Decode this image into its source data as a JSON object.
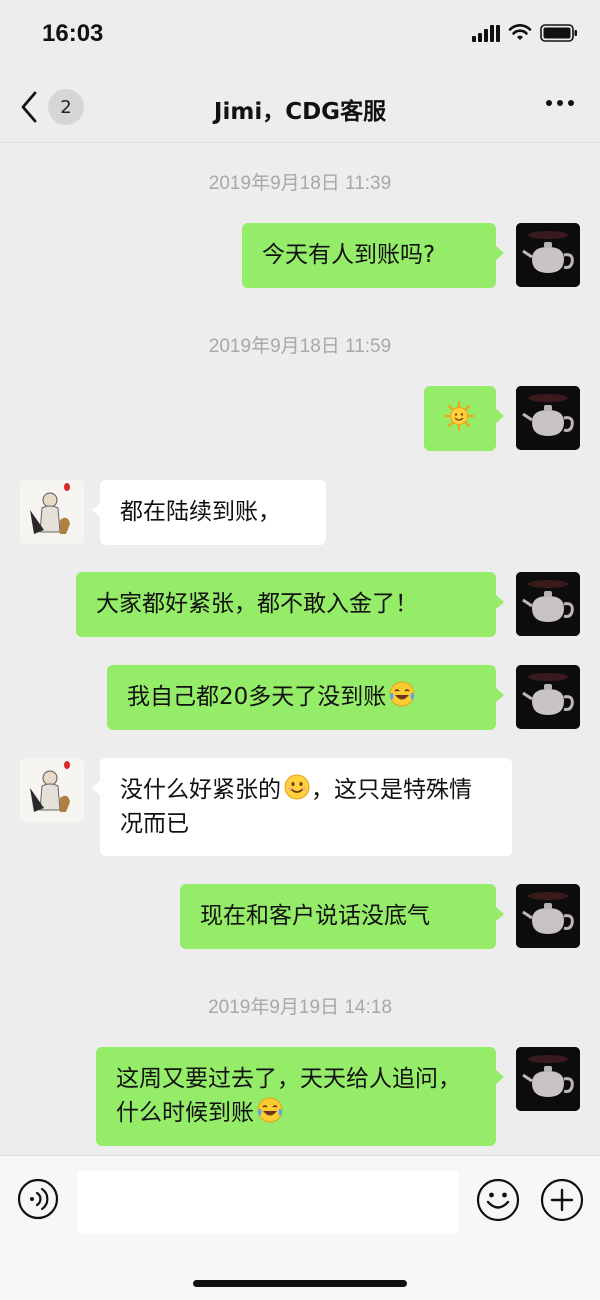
{
  "status_bar": {
    "time": "16:03"
  },
  "nav": {
    "back_count": "2",
    "title": "Jimi，CDG客服"
  },
  "messages": [
    {
      "type": "time",
      "text": "2019年9月18日 11:39"
    },
    {
      "type": "msg",
      "sender": "self",
      "text": "今天有人到账吗?"
    },
    {
      "type": "time",
      "text": "2019年9月18日 11:59"
    },
    {
      "type": "msg",
      "sender": "self",
      "emoji": "sun-emoji"
    },
    {
      "type": "msg",
      "sender": "other",
      "text": "都在陆续到账，"
    },
    {
      "type": "msg",
      "sender": "self",
      "text": "大家都好紧张，都不敢入金了！"
    },
    {
      "type": "msg",
      "sender": "self",
      "text": "我自己都20多天了没到账",
      "emoji": "laugh-cry-emoji"
    },
    {
      "type": "msg",
      "sender": "other",
      "text": " 没什么好紧张的",
      "emoji": "smile-emoji",
      "text_after": "，这只是特殊情况而已"
    },
    {
      "type": "msg",
      "sender": "self",
      "text": "现在和客户说话没底气"
    },
    {
      "type": "time",
      "text": "2019年9月19日 14:18"
    },
    {
      "type": "msg",
      "sender": "self",
      "text": "这周又要过去了，天天给人追问，什么时候到账",
      "emoji": "laugh-cry-emoji"
    }
  ],
  "input_bar": {
    "placeholder": "",
    "value": ""
  },
  "colors": {
    "self_bubble": "#95ec69",
    "other_bubble": "#ffffff",
    "background": "#ededed"
  }
}
